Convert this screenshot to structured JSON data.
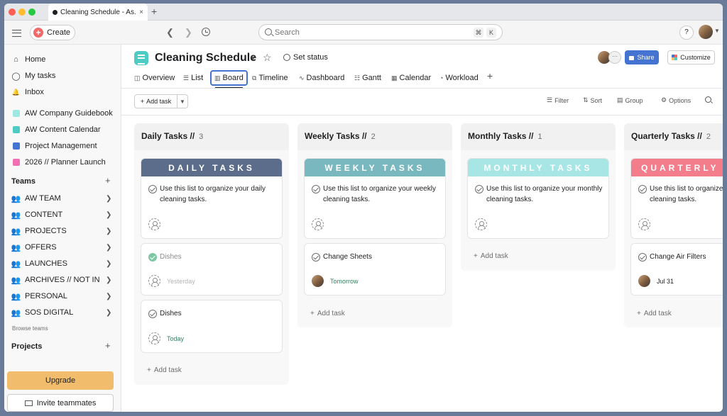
{
  "browser": {
    "tab_title": "Cleaning Schedule - As...",
    "tab_close": "×",
    "new_tab": "+"
  },
  "topbar": {
    "create_label": "Create",
    "search_placeholder": "Search",
    "shortcut_keys": [
      "⌘",
      "K"
    ],
    "help_label": "?"
  },
  "sidebar": {
    "nav": [
      {
        "label": "Home",
        "icon": "home-icon",
        "glyph": "⌂"
      },
      {
        "label": "My tasks",
        "icon": "check-circle-icon",
        "glyph": "◯"
      },
      {
        "label": "Inbox",
        "icon": "bell-icon",
        "glyph": "🔔"
      }
    ],
    "projects_top": [
      {
        "label": "AW Company Guidebook",
        "color": "#9ee7e3"
      },
      {
        "label": "AW Content Calendar",
        "color": "#4ecbc4"
      },
      {
        "label": "Project Management",
        "color": "#4573d2"
      },
      {
        "label": "2026 // Planner Launch",
        "color": "#f26fb2"
      }
    ],
    "teams_heading": "Teams",
    "teams": [
      "AW TEAM",
      "CONTENT",
      "PROJECTS",
      "OFFERS",
      "LAUNCHES",
      "ARCHIVES // NOT IN...",
      "PERSONAL",
      "SOS DIGITAL"
    ],
    "browse_teams": "Browse teams",
    "projects_heading": "Projects",
    "upgrade_label": "Upgrade",
    "invite_label": "Invite teammates"
  },
  "project": {
    "title": "Cleaning Schedule",
    "set_status": "Set status",
    "share_label": "Share",
    "customize_label": "Customize",
    "member_more": "···"
  },
  "views": [
    {
      "label": "Overview",
      "glyph": "◫"
    },
    {
      "label": "List",
      "glyph": "☰"
    },
    {
      "label": "Board",
      "glyph": "▥"
    },
    {
      "label": "Timeline",
      "glyph": "⧉"
    },
    {
      "label": "Dashboard",
      "glyph": "∿"
    },
    {
      "label": "Gantt",
      "glyph": "☷"
    },
    {
      "label": "Calendar",
      "glyph": "▦"
    },
    {
      "label": "Workload",
      "glyph": "◔"
    }
  ],
  "toolbar": {
    "add_task": "Add task",
    "filter": "Filter",
    "sort": "Sort",
    "group": "Group",
    "options": "Options"
  },
  "columns": [
    {
      "name": "Daily Tasks //",
      "count": "3",
      "banner": "DAILY TASKS",
      "banner_color": "#5b6d8b",
      "intro": "Use this list to organize your daily cleaning tasks.",
      "tasks": [
        {
          "title": "Dishes",
          "due": "Yesterday",
          "done": true
        },
        {
          "title": "Dishes",
          "due": "Today",
          "done": false
        }
      ],
      "add_task": "Add task"
    },
    {
      "name": "Weekly Tasks //",
      "count": "2",
      "banner": "WEEKLY TASKS",
      "banner_color": "#7ab8c0",
      "intro": "Use this list to organize your weekly cleaning tasks.",
      "tasks": [
        {
          "title": "Change Sheets",
          "due": "Tomorrow",
          "done": false
        }
      ],
      "add_task": "Add task"
    },
    {
      "name": "Monthly Tasks //",
      "count": "1",
      "banner": "MONTHLY TASKS",
      "banner_color": "#a8e6e6",
      "intro": "Use this list to organize your monthly cleaning tasks.",
      "tasks": [],
      "add_task": "Add task"
    },
    {
      "name": "Quarterly Tasks //",
      "count": "2",
      "banner": "QUARTERLY",
      "banner_color": "#f47d8c",
      "intro": "Use this list to organize your quarterly cleaning tasks.",
      "tasks": [
        {
          "title": "Change Air Filters",
          "due": "Jul 31",
          "done": false
        }
      ],
      "add_task": "Add task"
    }
  ]
}
